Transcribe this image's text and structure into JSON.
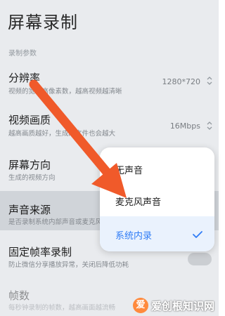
{
  "page": {
    "title": "屏幕录制",
    "section_label": "录制参数"
  },
  "settings": [
    {
      "label": "分辨率",
      "desc": "视频的宽、高像素数，越高视频越清晰",
      "value": "1280*720"
    },
    {
      "label": "视频画质",
      "desc": "越高画质越好，生成的文件也会越大",
      "value": "16Mbps"
    },
    {
      "label": "屏幕方向",
      "desc": "生成的视频方向",
      "value": ""
    },
    {
      "label": "声音来源",
      "desc": "是否录制系统内部声音或麦克风声音",
      "value": ""
    },
    {
      "label": "固定帧率录制",
      "desc": "防止微信分享播放异常，关闭后降低功耗",
      "value": ""
    },
    {
      "label": "帧数",
      "desc": "每秒钟录制的帧数，越高画面越流畅",
      "value": ""
    }
  ],
  "sound_source_popup": {
    "options": [
      "无声音",
      "麦克风声音",
      "系统内录"
    ],
    "selected": "系统内录"
  },
  "watermark": {
    "text": "爱创根知识网",
    "logo_char": "爱"
  },
  "colors": {
    "accent": "#2f7cf6",
    "arrow": "#f05a2a",
    "background": "#f3f5f8"
  }
}
